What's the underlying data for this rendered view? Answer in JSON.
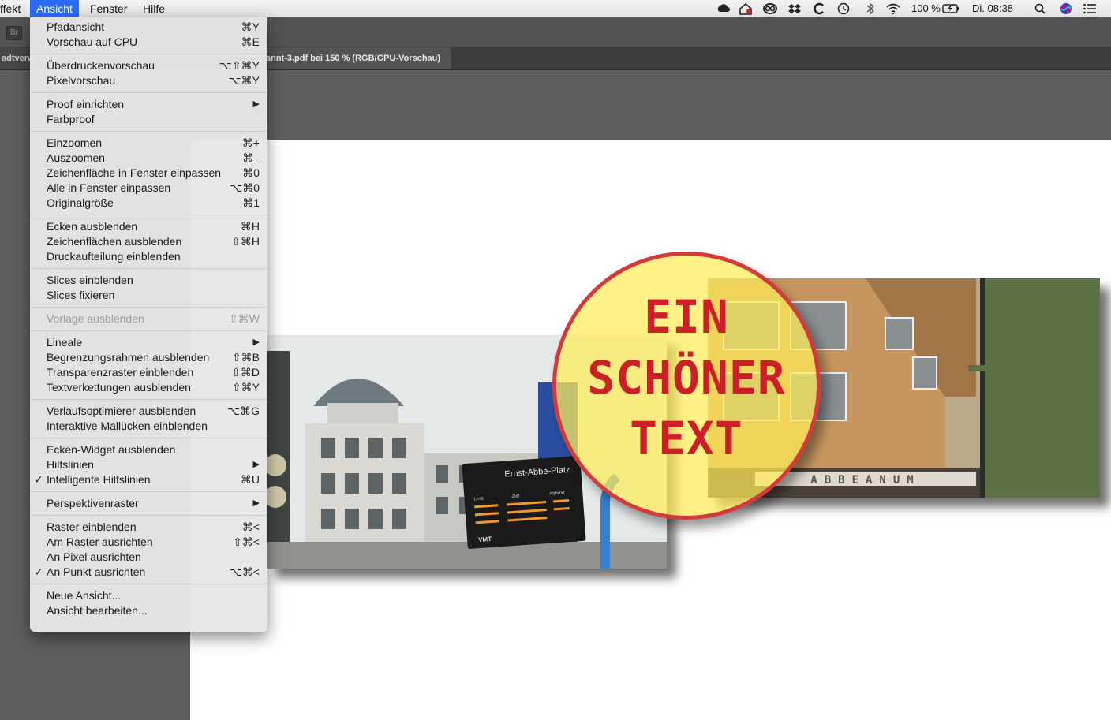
{
  "menubar": {
    "items": [
      "ffekt",
      "Ansicht",
      "Fenster",
      "Hilfe"
    ],
    "active_index": 1,
    "battery": "100 %",
    "clock": "Di. 08:38",
    "status_icons": [
      "creative-cloud-icon",
      "backup-icon",
      "adobe-cc-icon",
      "dropbox-icon",
      "c-app-icon",
      "time-machine-icon",
      "bluetooth-icon",
      "wifi-icon",
      "battery-icon",
      "search-icon",
      "siri-icon",
      "notification-center-icon"
    ]
  },
  "app": {
    "bridge_label": "Br",
    "tabs": [
      {
        "label": "adtverw"
      },
      {
        "label": "annt-3.pdf bei 150 % (RGB/GPU-Vorschau)"
      }
    ]
  },
  "view_menu": {
    "groups": [
      [
        {
          "label": "Pfadansicht",
          "shortcut": "⌘Y"
        },
        {
          "label": "Vorschau auf CPU",
          "shortcut": "⌘E"
        }
      ],
      [
        {
          "label": "Überdruckenvorschau",
          "shortcut": "⌥⇧⌘Y"
        },
        {
          "label": "Pixelvorschau",
          "shortcut": "⌥⌘Y"
        }
      ],
      [
        {
          "label": "Proof einrichten",
          "shortcut": "▶"
        },
        {
          "label": "Farbproof",
          "shortcut": ""
        }
      ],
      [
        {
          "label": "Einzoomen",
          "shortcut": "⌘+"
        },
        {
          "label": "Auszoomen",
          "shortcut": "⌘–"
        },
        {
          "label": "Zeichenfläche in Fenster einpassen",
          "shortcut": "⌘0"
        },
        {
          "label": "Alle in Fenster einpassen",
          "shortcut": "⌥⌘0"
        },
        {
          "label": "Originalgröße",
          "shortcut": "⌘1"
        }
      ],
      [
        {
          "label": "Ecken ausblenden",
          "shortcut": "⌘H"
        },
        {
          "label": "Zeichenflächen ausblenden",
          "shortcut": "⇧⌘H"
        },
        {
          "label": "Druckaufteilung einblenden",
          "shortcut": ""
        }
      ],
      [
        {
          "label": "Slices einblenden",
          "shortcut": ""
        },
        {
          "label": "Slices fixieren",
          "shortcut": ""
        }
      ],
      [
        {
          "label": "Vorlage ausblenden",
          "shortcut": "⇧⌘W",
          "disabled": true
        }
      ],
      [
        {
          "label": "Lineale",
          "shortcut": "▶"
        },
        {
          "label": "Begrenzungsrahmen ausblenden",
          "shortcut": "⇧⌘B"
        },
        {
          "label": "Transparenzraster einblenden",
          "shortcut": "⇧⌘D"
        },
        {
          "label": "Textverkettungen ausblenden",
          "shortcut": "⇧⌘Y"
        }
      ],
      [
        {
          "label": "Verlaufsoptimierer ausblenden",
          "shortcut": "⌥⌘G"
        },
        {
          "label": "Interaktive Mallücken einblenden",
          "shortcut": ""
        }
      ],
      [
        {
          "label": "Ecken-Widget ausblenden",
          "shortcut": ""
        },
        {
          "label": "Hilfslinien",
          "shortcut": "▶"
        },
        {
          "label": "Intelligente Hilfslinien",
          "shortcut": "⌘U",
          "checked": true
        }
      ],
      [
        {
          "label": "Perspektivenraster",
          "shortcut": "▶"
        }
      ],
      [
        {
          "label": "Raster einblenden",
          "shortcut": "⌘<"
        },
        {
          "label": "Am Raster ausrichten",
          "shortcut": "⇧⌘<"
        },
        {
          "label": "An Pixel ausrichten",
          "shortcut": ""
        },
        {
          "label": "An Punkt ausrichten",
          "shortcut": "⌥⌘<",
          "checked": true
        }
      ],
      [
        {
          "label": "Neue Ansicht...",
          "shortcut": ""
        },
        {
          "label": "Ansicht bearbeiten...",
          "shortcut": ""
        }
      ]
    ]
  },
  "artwork": {
    "badge_lines": [
      "EIN",
      "SCHÖNER",
      "TEXT"
    ],
    "sign_text": "Ernst-Abbe-Platz",
    "sign_cols": [
      "Linie",
      "Ziel",
      "Abfahrt"
    ],
    "sign_logo": "VMT",
    "facade_lettering": "ABBEANUM",
    "badge_fill": "#ffec56",
    "badge_border": "#d33a3b",
    "badge_text_color": "#cc1f28"
  }
}
